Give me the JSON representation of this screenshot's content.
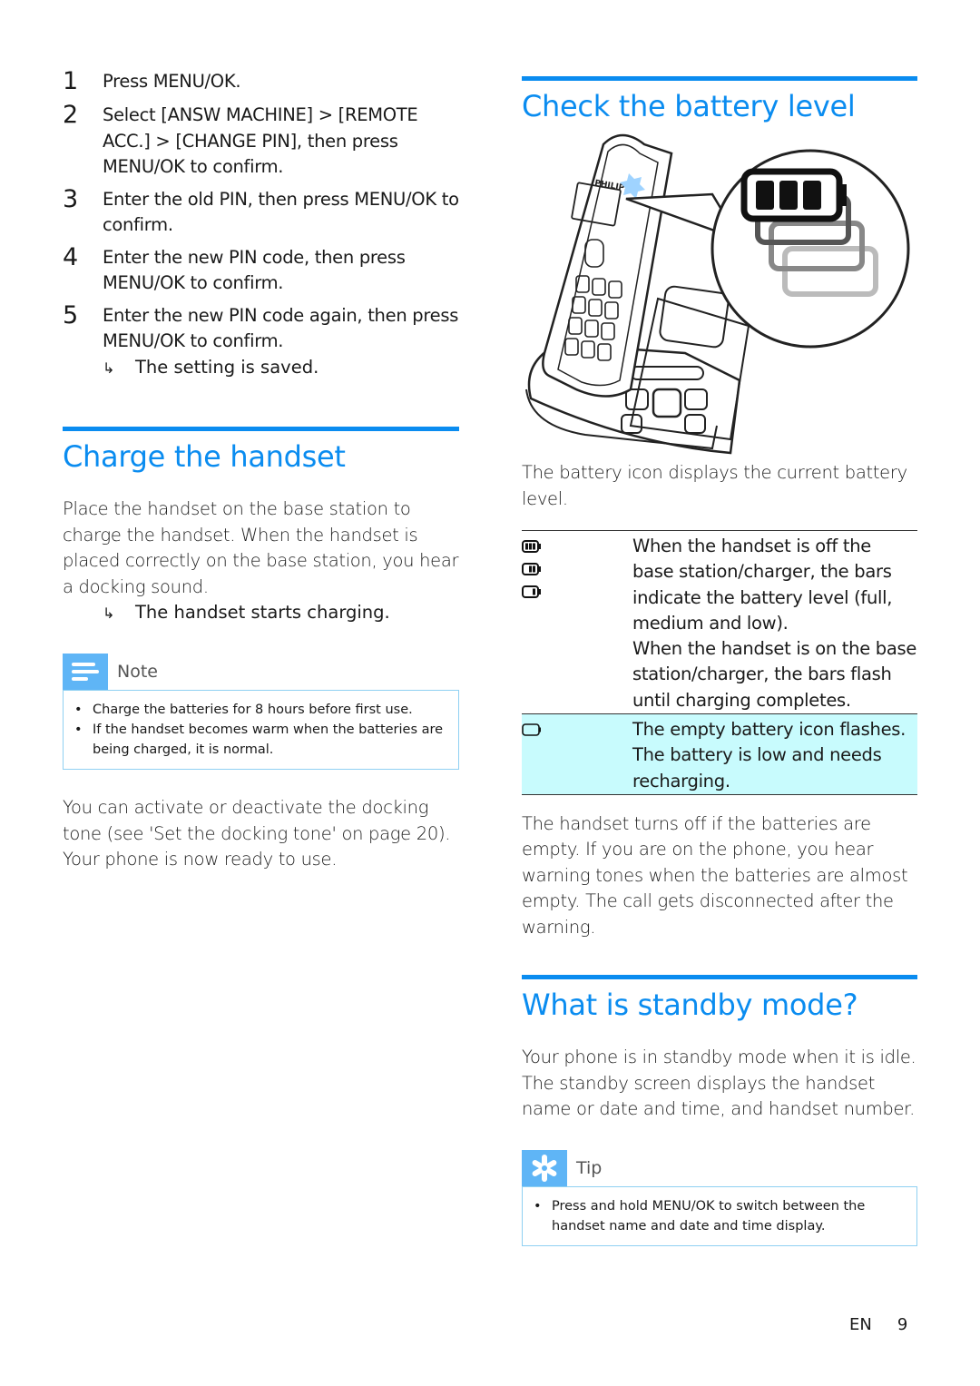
{
  "steps": [
    {
      "num": "1",
      "parts": [
        "Press ",
        "MENU/OK",
        "."
      ]
    },
    {
      "num": "2",
      "parts": [
        "Select ",
        "[ANSW MACHINE] > [REMOTE ACC.] > [CHANGE PIN]",
        ", then press ",
        "MENU/OK",
        " to confirm."
      ]
    },
    {
      "num": "3",
      "parts": [
        "Enter the old PIN, then press ",
        "MENU/OK",
        " to confirm."
      ]
    },
    {
      "num": "4",
      "parts": [
        "Enter the new PIN code, then press ",
        "MENU/OK",
        " to confirm."
      ]
    },
    {
      "num": "5",
      "parts": [
        "Enter the new PIN code again, then press ",
        "MENU/OK",
        " to confirm."
      ]
    }
  ],
  "steps_result": "The setting is saved.",
  "result_arrow": "↳",
  "charge": {
    "title": "Charge the handset",
    "paragraph": "Place the handset on the base station to charge the handset. When the handset is placed correctly on the base station, you hear a docking sound.",
    "result": "The handset starts charging.",
    "note": {
      "label": "Note",
      "items": [
        "Charge the batteries for 8 hours before first use.",
        "If the handset becomes warm when the batteries are being charged, it is normal."
      ]
    },
    "after_note": "You can activate or deactivate the docking tone (see 'Set the docking tone' on page 20).",
    "ready": "Your phone is now ready to use."
  },
  "battery": {
    "title": "Check the battery level",
    "illustration": {
      "brand": "PHILIPS",
      "battery_levels_shown": [
        "full",
        "medium",
        "low",
        "empty"
      ]
    },
    "intro": "The battery icon displays the current battery level.",
    "rows": [
      {
        "icons": [
          "battery-full-icon",
          "battery-medium-icon",
          "battery-low-icon"
        ],
        "text_lines": [
          "When the handset is off the base station/charger, the bars indicate the battery level (full, medium and low).",
          "When the handset is on the base station/charger, the bars flash until charging completes."
        ],
        "highlight": false
      },
      {
        "icons": [
          "battery-empty-icon"
        ],
        "text_lines": [
          "The empty battery icon flashes. The battery is low and needs recharging."
        ],
        "highlight": true
      }
    ],
    "after_table": "The handset turns off if the batteries are empty. If you are on the phone, you hear warning tones when the batteries are almost empty. The call gets disconnected after the warning."
  },
  "standby": {
    "title": "What is standby mode?",
    "paragraph": "Your phone is in standby mode when it is idle. The standby screen displays the handset name or date and time, and handset number.",
    "tip": {
      "label": "Tip",
      "items": [
        [
          "Press and hold ",
          "MENU/OK",
          " to switch between the handset name and date and time display."
        ]
      ]
    }
  },
  "footer": {
    "lang": "EN",
    "page": "9"
  },
  "colors": {
    "accent": "#0a8cf0",
    "box_icon": "#5fb5f6",
    "box_border": "#8fd0f2",
    "highlight_row": "#c8fbfd"
  }
}
